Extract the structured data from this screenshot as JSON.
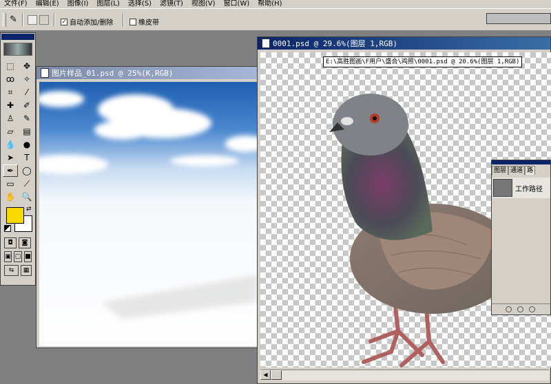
{
  "menu": [
    "文件(F)",
    "编辑(E)",
    "图像(I)",
    "图层(L)",
    "选择(S)",
    "滤镜(T)",
    "视图(V)",
    "窗口(W)",
    "帮助(H)"
  ],
  "options": {
    "auto_add_delete": "自动添加/删除",
    "auto_add_delete_checked": true,
    "rubber_band": "橡皮带",
    "rubber_band_checked": false
  },
  "windows": {
    "sky": {
      "title": "图片样品_01.psd @ 25%(K,RGB)"
    },
    "pigeon": {
      "title": "0001.psd @ 29.6%(图层 1,RGB)",
      "tooltip": "E:\\高胜图画\\F用户\\盛合\\鸡照\\0001.psd @ 20.6%(图层 1,RGB)"
    }
  },
  "layers_panel": {
    "tabs": [
      "图层",
      "通道",
      "路"
    ],
    "active_tab": 2,
    "item": "工作路径"
  },
  "toolbox": {
    "tools": [
      "marquee-icon",
      "move-icon",
      "lasso-icon",
      "magic-wand-icon",
      "crop-icon",
      "slice-icon",
      "healing-brush-icon",
      "brush-icon",
      "clone-stamp-icon",
      "history-brush-icon",
      "eraser-icon",
      "gradient-icon",
      "blur-icon",
      "dodge-icon",
      "path-selection-icon",
      "type-icon",
      "pen-icon",
      "shape-icon",
      "notes-icon",
      "eyedropper-icon",
      "hand-icon",
      "zoom-icon"
    ],
    "foreground": "#f7d900",
    "background": "#ffffff"
  }
}
